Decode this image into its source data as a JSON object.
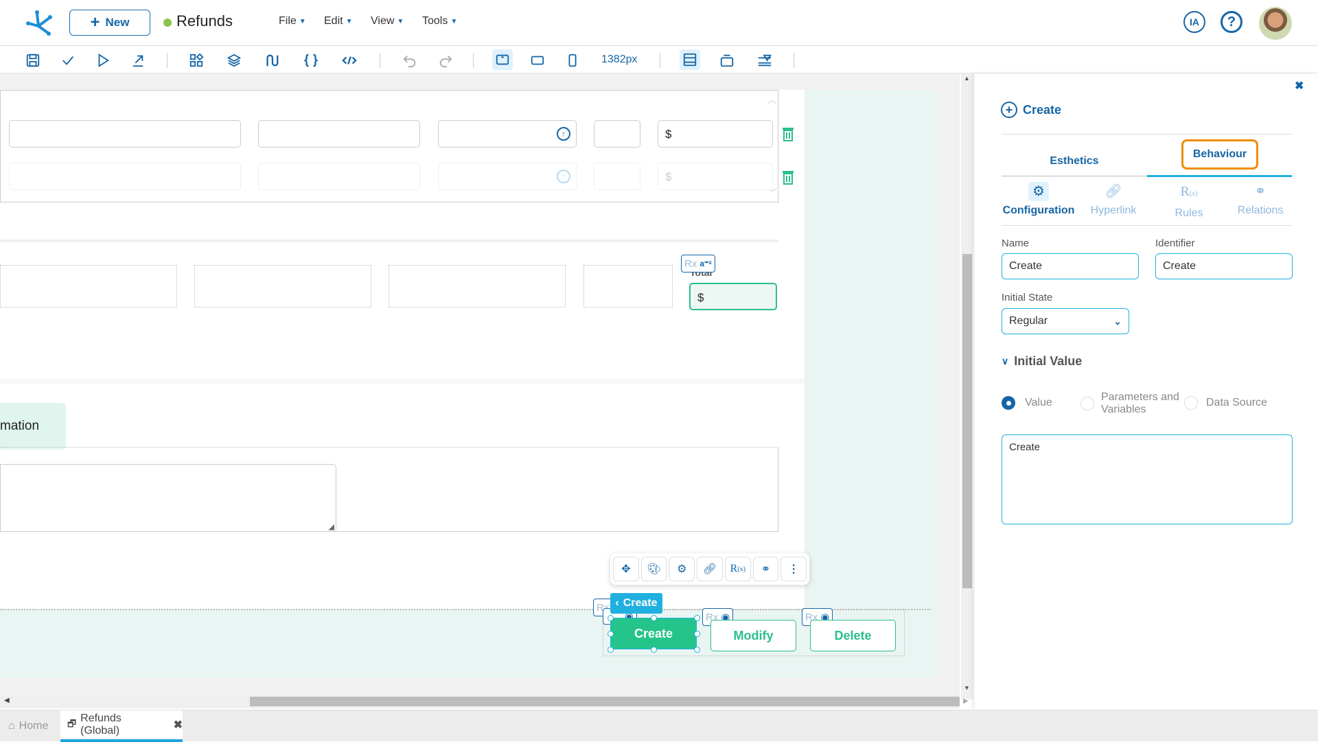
{
  "header": {
    "new_label": "New",
    "app_title": "Refunds",
    "status_color": "#8bc34a",
    "menus": [
      "File",
      "Edit",
      "View",
      "Tools"
    ],
    "ia_label": "IA",
    "help_icon": "question-circle-icon"
  },
  "toolbar": {
    "width_readout": "1382px",
    "icons": [
      "save-icon",
      "check-icon",
      "play-icon",
      "export-icon",
      "components-icon",
      "layers-icon",
      "flow-icon",
      "braces-icon",
      "code-icon",
      "undo-icon",
      "redo-icon",
      "desktop-icon",
      "tablet-icon",
      "mobile-icon",
      "layout-icon",
      "container-icon",
      "filter-icon"
    ]
  },
  "canvas": {
    "currency_symbol": "$",
    "total_label": "Total",
    "information_label": "mation",
    "rx_label": "Rx",
    "actions": {
      "create": "Create",
      "modify": "Modify",
      "delete": "Delete"
    },
    "breadcrumb_chip": "Create"
  },
  "panel": {
    "title": "Create",
    "tabs": {
      "esthetics": "Esthetics",
      "behaviour": "Behaviour"
    },
    "subtabs": [
      "Configuration",
      "Hyperlink",
      "Rules",
      "Relations"
    ],
    "name_label": "Name",
    "name_value": "Create",
    "identifier_label": "Identifier",
    "identifier_value": "Create",
    "initial_state_label": "Initial State",
    "initial_state_value": "Regular",
    "initial_value_section": "Initial Value",
    "radio_options": {
      "value": "Value",
      "params": "Parameters and Variables",
      "datasource": "Data Source"
    },
    "selected_radio": "Value",
    "value_text": "Create",
    "accent_color": "#1565a6",
    "highlight_color": "#f08c00"
  },
  "bottom_tabs": {
    "home": "Home",
    "active": "Refunds (Global)"
  }
}
